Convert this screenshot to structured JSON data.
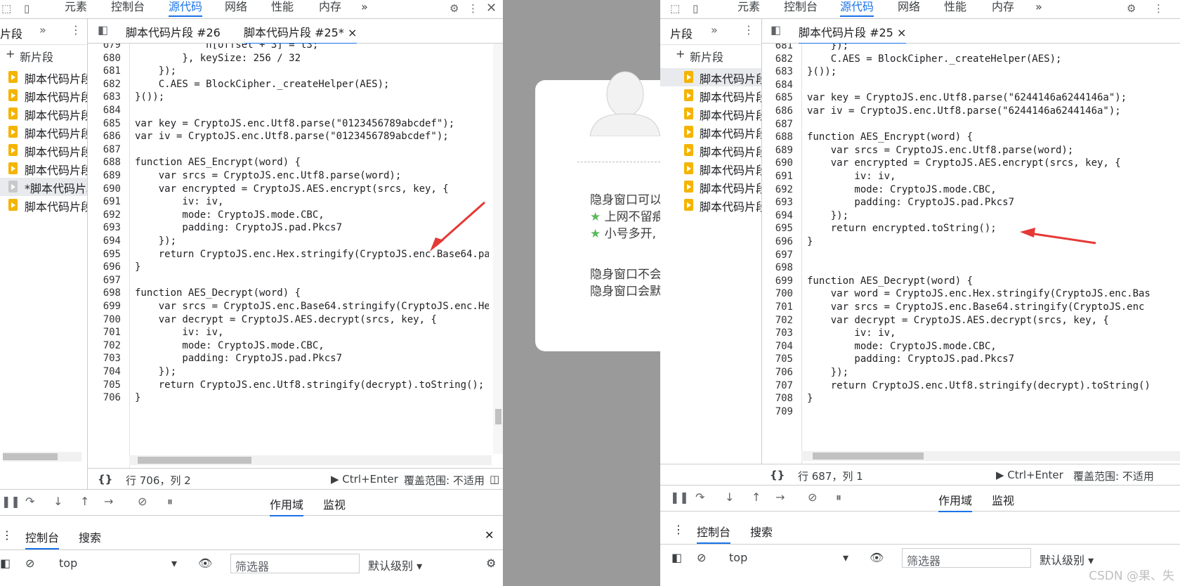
{
  "left": {
    "tabs": [
      "元素",
      "控制台",
      "源代码",
      "网络",
      "性能",
      "内存"
    ],
    "active_tab": "源代码",
    "more": "»",
    "sidebar_title": "片段",
    "new_snippet": "新片段",
    "snippets": [
      "脚本代码片段",
      "脚本代码片段",
      "脚本代码片段",
      "脚本代码片段",
      "脚本代码片段",
      "脚本代码片段",
      "*脚本代码片段",
      "脚本代码片段"
    ],
    "file_tabs": [
      "脚本代码片段 #26",
      "脚本代码片段 #25*"
    ],
    "close": "×",
    "code": [
      {
        "n": "679",
        "t": "            h[offset + 3] = t3;"
      },
      {
        "n": "680",
        "t": "        }, keySize: 256 / 32"
      },
      {
        "n": "681",
        "t": "    });"
      },
      {
        "n": "682",
        "t": "    C.AES = BlockCipher._createHelper(AES);"
      },
      {
        "n": "683",
        "t": "}());"
      },
      {
        "n": "684",
        "t": ""
      },
      {
        "n": "685",
        "t": "var key = CryptoJS.enc.Utf8.parse(\"0123456789abcdef\");"
      },
      {
        "n": "686",
        "t": "var iv = CryptoJS.enc.Utf8.parse(\"0123456789abcdef\");"
      },
      {
        "n": "687",
        "t": ""
      },
      {
        "n": "688",
        "t": "function AES_Encrypt(word) {"
      },
      {
        "n": "689",
        "t": "    var srcs = CryptoJS.enc.Utf8.parse(word);"
      },
      {
        "n": "690",
        "t": "    var encrypted = CryptoJS.AES.encrypt(srcs, key, {"
      },
      {
        "n": "691",
        "t": "        iv: iv,"
      },
      {
        "n": "692",
        "t": "        mode: CryptoJS.mode.CBC,"
      },
      {
        "n": "693",
        "t": "        padding: CryptoJS.pad.Pkcs7"
      },
      {
        "n": "694",
        "t": "    });"
      },
      {
        "n": "695",
        "t": "    return CryptoJS.enc.Hex.stringify(CryptoJS.enc.Base64.pa"
      },
      {
        "n": "696",
        "t": "}"
      },
      {
        "n": "697",
        "t": ""
      },
      {
        "n": "698",
        "t": "function AES_Decrypt(word) {"
      },
      {
        "n": "699",
        "t": "    var srcs = CryptoJS.enc.Base64.stringify(CryptoJS.enc.He"
      },
      {
        "n": "700",
        "t": "    var decrypt = CryptoJS.AES.decrypt(srcs, key, {"
      },
      {
        "n": "701",
        "t": "        iv: iv,"
      },
      {
        "n": "702",
        "t": "        mode: CryptoJS.mode.CBC,"
      },
      {
        "n": "703",
        "t": "        padding: CryptoJS.pad.Pkcs7"
      },
      {
        "n": "704",
        "t": "    });"
      },
      {
        "n": "705",
        "t": "    return CryptoJS.enc.Utf8.stringify(decrypt).toString();"
      },
      {
        "n": "706",
        "t": "}"
      }
    ],
    "status_braces": "{}",
    "status_pos": "行 706，列 2",
    "run": "▶ Ctrl+Enter",
    "coverage": "覆盖范围: 不适用",
    "scope_tabs": [
      "作用域",
      "监视"
    ],
    "console_tabs": [
      "控制台",
      "搜索"
    ],
    "context": "top",
    "filter_placeholder": "筛选器",
    "level": "默认级别 ▾"
  },
  "middle": {
    "lines": [
      "隐身窗口可以",
      "上网不留痕",
      "小号多开,",
      "隐身窗口不会",
      "隐身窗口会默"
    ]
  },
  "right": {
    "tabs": [
      "元素",
      "控制台",
      "源代码",
      "网络",
      "性能",
      "内存"
    ],
    "active_tab": "源代码",
    "more": "»",
    "sidebar_title": "片段",
    "new_snippet": "新片段",
    "snippets": [
      "脚本代码片段",
      "脚本代码片段",
      "脚本代码片段",
      "脚本代码片段",
      "脚本代码片段",
      "脚本代码片段",
      "脚本代码片段",
      "脚本代码片段"
    ],
    "file_tabs": [
      "脚本代码片段 #25"
    ],
    "close": "×",
    "code": [
      {
        "n": "681",
        "t": "    });"
      },
      {
        "n": "682",
        "t": "    C.AES = BlockCipher._createHelper(AES);"
      },
      {
        "n": "683",
        "t": "}());"
      },
      {
        "n": "684",
        "t": ""
      },
      {
        "n": "685",
        "t": "var key = CryptoJS.enc.Utf8.parse(\"6244146a6244146a\");"
      },
      {
        "n": "686",
        "t": "var iv = CryptoJS.enc.Utf8.parse(\"6244146a6244146a\");"
      },
      {
        "n": "687",
        "t": ""
      },
      {
        "n": "688",
        "t": "function AES_Encrypt(word) {"
      },
      {
        "n": "689",
        "t": "    var srcs = CryptoJS.enc.Utf8.parse(word);"
      },
      {
        "n": "690",
        "t": "    var encrypted = CryptoJS.AES.encrypt(srcs, key, {"
      },
      {
        "n": "691",
        "t": "        iv: iv,"
      },
      {
        "n": "692",
        "t": "        mode: CryptoJS.mode.CBC,"
      },
      {
        "n": "693",
        "t": "        padding: CryptoJS.pad.Pkcs7"
      },
      {
        "n": "694",
        "t": "    });"
      },
      {
        "n": "695",
        "t": "    return encrypted.toString();"
      },
      {
        "n": "696",
        "t": "}"
      },
      {
        "n": "697",
        "t": ""
      },
      {
        "n": "698",
        "t": ""
      },
      {
        "n": "699",
        "t": "function AES_Decrypt(word) {"
      },
      {
        "n": "700",
        "t": "    var word = CryptoJS.enc.Hex.stringify(CryptoJS.enc.Bas"
      },
      {
        "n": "701",
        "t": "    var srcs = CryptoJS.enc.Base64.stringify(CryptoJS.enc"
      },
      {
        "n": "702",
        "t": "    var decrypt = CryptoJS.AES.decrypt(srcs, key, {"
      },
      {
        "n": "703",
        "t": "        iv: iv,"
      },
      {
        "n": "704",
        "t": "        mode: CryptoJS.mode.CBC,"
      },
      {
        "n": "705",
        "t": "        padding: CryptoJS.pad.Pkcs7"
      },
      {
        "n": "706",
        "t": "    });"
      },
      {
        "n": "707",
        "t": "    return CryptoJS.enc.Utf8.stringify(decrypt).toString()"
      },
      {
        "n": "708",
        "t": "}"
      },
      {
        "n": "709",
        "t": ""
      }
    ],
    "status_braces": "{}",
    "status_pos": "行 687，列 1",
    "run": "▶ Ctrl+Enter",
    "coverage": "覆盖范围: 不适用",
    "scope_tabs": [
      "作用域",
      "监视"
    ],
    "console_tabs": [
      "控制台",
      "搜索"
    ],
    "context": "top",
    "filter_placeholder": "筛选器",
    "level": "默认级别 ▾"
  },
  "watermark": "CSDN @果、失",
  "colors": {
    "accent": "#1a73e8",
    "snippet_icon": "#f4b400",
    "arrow": "#e53935",
    "keyword": "#1a1aa6",
    "string": "#c41a16"
  }
}
